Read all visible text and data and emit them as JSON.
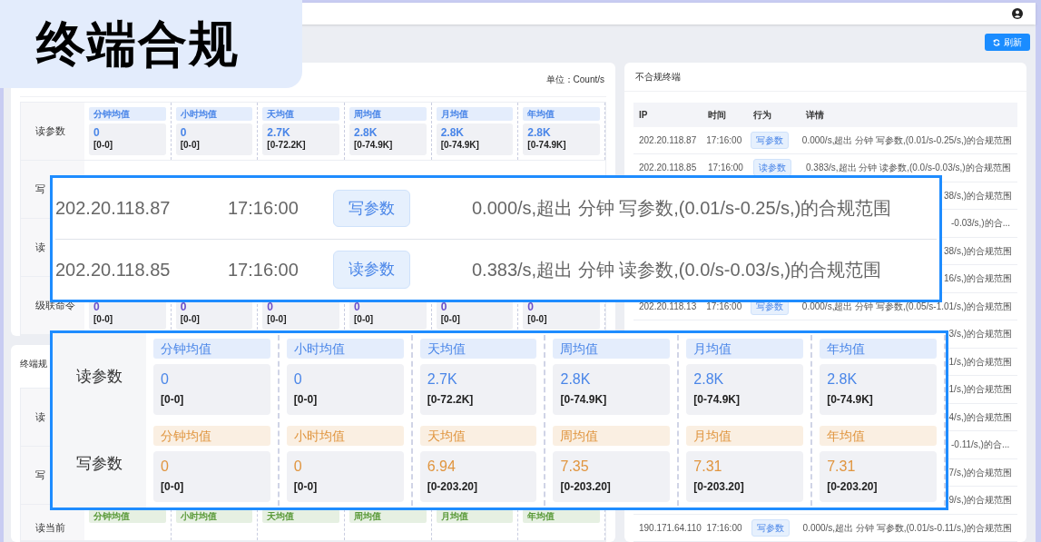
{
  "badge": {
    "title": "终端合规"
  },
  "header": {
    "refresh_button": "刷新"
  },
  "stats_card": {
    "unit": "单位：Count/s",
    "rows": [
      {
        "label": "读参数",
        "kind": "full",
        "color": "#4a86e8",
        "cells": [
          {
            "period": "分钟均值",
            "value": "0",
            "range": "[0-0]"
          },
          {
            "period": "小时均值",
            "value": "0",
            "range": "[0-0]"
          },
          {
            "period": "天均值",
            "value": "2.7K",
            "range": "[0-72.2K]"
          },
          {
            "period": "周均值",
            "value": "2.8K",
            "range": "[0-74.9K]"
          },
          {
            "period": "月均值",
            "value": "2.8K",
            "range": "[0-74.9K]"
          },
          {
            "period": "年均值",
            "value": "2.8K",
            "range": "[0-74.9K]"
          }
        ]
      },
      {
        "label": "写",
        "kind": "label_only"
      },
      {
        "label": "读",
        "kind": "label_only"
      },
      {
        "label": "级联命令",
        "kind": "values_only",
        "color": "#6b4fc8",
        "cells": [
          {
            "value": "0",
            "range": "[0-0]"
          },
          {
            "value": "0",
            "range": "[0-0]"
          },
          {
            "value": "0",
            "range": "[0-0]"
          },
          {
            "value": "0",
            "range": "[0-0]"
          },
          {
            "value": "0",
            "range": "[0-0]"
          },
          {
            "value": "0",
            "range": "[0-0]"
          }
        ]
      }
    ]
  },
  "second_card": {
    "title": "终端规",
    "rows": [
      {
        "label": "读",
        "kind": "label_only"
      },
      {
        "label": "写",
        "kind": "label_only"
      },
      {
        "label": "读当前",
        "kind": "headers_only",
        "color": "#5a9a3a",
        "cells": [
          {
            "period": "分钟均值"
          },
          {
            "period": "小时均值"
          },
          {
            "period": "天均值"
          },
          {
            "period": "周均值"
          },
          {
            "period": "月均值"
          },
          {
            "period": "年均值"
          }
        ]
      }
    ]
  },
  "noncompliant": {
    "title": "不合规终端",
    "columns": [
      "IP",
      "时间",
      "行为",
      "详情"
    ],
    "rows": [
      {
        "ip": "202.20.118.87",
        "time": "17:16:00",
        "action": "写参数",
        "detail": "0.000/s,超出 分钟 写参数,(0.01/s-0.25/s,)的合规范围"
      },
      {
        "ip": "202.20.118.85",
        "time": "17:16:00",
        "action": "读参数",
        "detail": "0.383/s,超出 分钟 读参数,(0.0/s-0.03/s,)的合规范围"
      },
      {
        "detail": "38/s,)的合规范围"
      },
      {
        "detail": "-0.03/s,)的合..."
      },
      {
        "detail": "38/s,)的合规范围"
      },
      {
        "detail": "16/s,)的合规范围"
      },
      {
        "ip": "202.20.118.13",
        "time": "17:16:00",
        "action": "写参数",
        "detail": "0.000/s,超出 分钟 写参数,(0.05/s-1.01/s,)的合规范围"
      },
      {
        "detail": "3/s,)的合规范围"
      },
      {
        "detail": "1/s,)的合规范围"
      },
      {
        "detail": "1/s,)的合规范围"
      },
      {
        "detail": "4/s,)的合规范围"
      },
      {
        "detail": "-0.11/s,)的合..."
      },
      {
        "detail": "7/s,)的合规范围"
      },
      {
        "detail": "9/s,)的合规范围"
      },
      {
        "ip": "190.171.64.110",
        "time": "17:16:00",
        "action": "写参数",
        "detail": "0.000/s,超出 分钟 写参数,(0.01/s-0.11/s,)的合规范围"
      }
    ]
  },
  "zoom_table": {
    "rows": [
      {
        "ip": "202.20.118.87",
        "time": "17:16:00",
        "action": "写参数",
        "detail": "0.000/s,超出 分钟 写参数,(0.01/s-0.25/s,)的合规范围"
      },
      {
        "ip": "202.20.118.85",
        "time": "17:16:00",
        "action": "读参数",
        "detail": "0.383/s,超出 分钟 读参数,(0.0/s-0.03/s,)的合规范围"
      }
    ]
  },
  "zoom_stats": {
    "rows": [
      {
        "label": "读参数",
        "color": "#4a86e8",
        "cells": [
          {
            "period": "分钟均值",
            "value": "0",
            "range": "[0-0]"
          },
          {
            "period": "小时均值",
            "value": "0",
            "range": "[0-0]"
          },
          {
            "period": "天均值",
            "value": "2.7K",
            "range": "[0-72.2K]"
          },
          {
            "period": "周均值",
            "value": "2.8K",
            "range": "[0-74.9K]"
          },
          {
            "period": "月均值",
            "value": "2.8K",
            "range": "[0-74.9K]"
          },
          {
            "period": "年均值",
            "value": "2.8K",
            "range": "[0-74.9K]"
          }
        ]
      },
      {
        "label": "写参数",
        "color": "#e0953f",
        "cells": [
          {
            "period": "分钟均值",
            "value": "0",
            "range": "[0-0]"
          },
          {
            "period": "小时均值",
            "value": "0",
            "range": "[0-0]"
          },
          {
            "period": "天均值",
            "value": "6.94",
            "range": "[0-203.20]"
          },
          {
            "period": "周均值",
            "value": "7.35",
            "range": "[0-203.20]"
          },
          {
            "period": "月均值",
            "value": "7.31",
            "range": "[0-203.20]"
          },
          {
            "period": "年均值",
            "value": "7.31",
            "range": "[0-203.20]"
          }
        ]
      }
    ]
  }
}
